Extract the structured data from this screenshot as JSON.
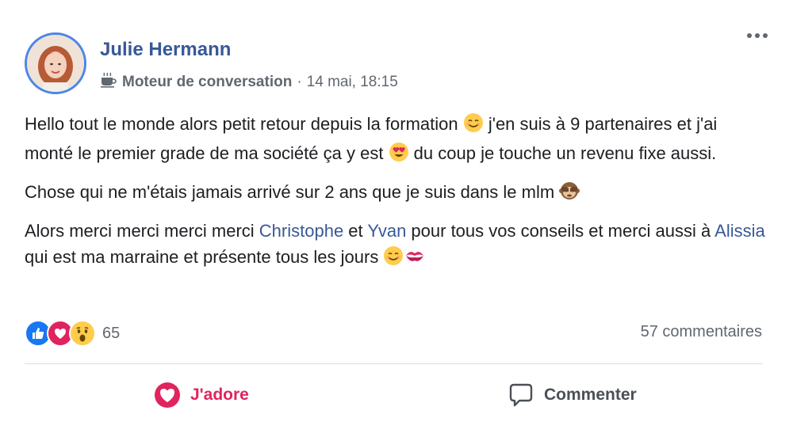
{
  "post": {
    "author": "Julie Hermann",
    "group": "Moteur de conversation",
    "separator": "·",
    "timestamp": "14 mai, 18:15",
    "paragraphs": [
      {
        "p1_a": "Hello tout le monde alors petit retour depuis la formation ",
        "p1_b": " j'en suis à 9 partenaires et j'ai monté le premier grade de ma société ça y est ",
        "p1_c": " du coup je touche un revenu fixe aussi."
      },
      {
        "p2_a": "Chose qui ne m'étais jamais arrivé sur 2 ans que je suis dans le mlm "
      },
      {
        "p3_a": "Alors merci merci merci merci ",
        "p3_link1": "Christophe",
        "p3_b": " et ",
        "p3_link2": "Yvan",
        "p3_c": " pour tous vos conseils et merci aussi à ",
        "p3_link3": "Alissia",
        "p3_d": " qui est ma marraine et présente tous les jours "
      }
    ],
    "reactions": {
      "icons": [
        "like-icon",
        "love-icon",
        "wow-icon"
      ],
      "count": "65"
    },
    "comments_count": "57 commentaires",
    "actions": {
      "love_label": "J'adore",
      "comment_label": "Commenter"
    },
    "colors": {
      "link": "#385898",
      "love": "#e0245e",
      "like": "#1877f2",
      "avatar_ring": "#4c86e6"
    }
  }
}
